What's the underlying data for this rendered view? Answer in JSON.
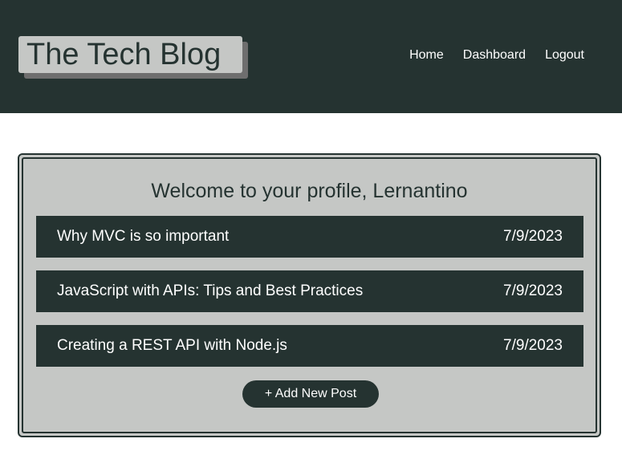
{
  "header": {
    "logo": "The Tech Blog",
    "nav": [
      "Home",
      "Dashboard",
      "Logout"
    ]
  },
  "profile": {
    "welcome": "Welcome to your profile, Lernantino",
    "posts": [
      {
        "title": "Why MVC is so important",
        "date": "7/9/2023"
      },
      {
        "title": "JavaScript with APIs: Tips and Best Practices",
        "date": "7/9/2023"
      },
      {
        "title": "Creating a REST API with Node.js",
        "date": "7/9/2023"
      }
    ],
    "add_button": "+ Add New Post"
  },
  "colors": {
    "primary_dark": "#253331",
    "light_gray": "#c5c7c5",
    "shadow_gray": "#6e6e6e"
  }
}
